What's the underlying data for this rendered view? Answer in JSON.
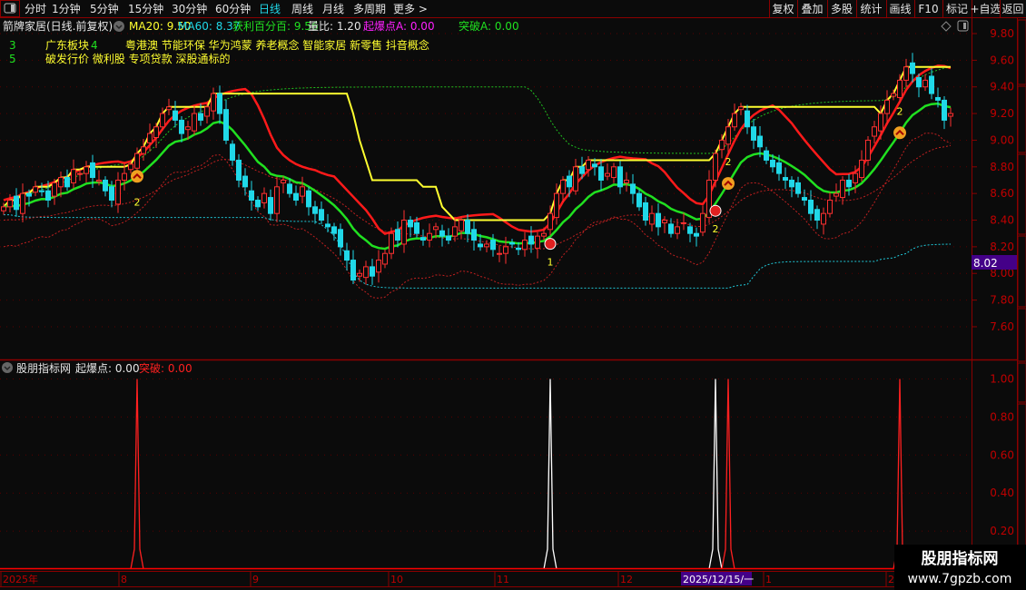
{
  "toolbar": {
    "periods": [
      "分时",
      "1分钟",
      "5分钟",
      "15分钟",
      "30分钟",
      "60分钟",
      "日线",
      "周线",
      "月线",
      "多周期",
      "更多 >"
    ],
    "active_period": "日线",
    "actions": [
      "复权",
      "叠加",
      "多股",
      "统计",
      "画线",
      "F10",
      "标记",
      "+自选",
      "返回"
    ]
  },
  "header": {
    "title": "箭牌家居(日线.前复权)",
    "ma20": "MA20: 9.50",
    "ma60": "MA60: 8.37",
    "profit": "获利百分百: 9.56",
    "volume_ratio": "量比: 1.20",
    "qibao_a": "起爆点A: 0.00",
    "tupo_a": "突破A: 0.00"
  },
  "info": {
    "row1_num": "3",
    "row1_label": "广东板块",
    "row1_count": "4",
    "row1_concepts": "粤港澳 节能环保 华为鸿蒙 养老概念 智能家居 新零售 抖音概念",
    "row2_num": "5",
    "row2_concepts": "破发行价 微利股 专项贷款 深股通标的"
  },
  "price_axis": {
    "ticks": [
      "9.80",
      "9.60",
      "9.40",
      "9.20",
      "9.00",
      "8.80",
      "8.60",
      "8.40",
      "8.20",
      "8.00",
      "7.80",
      "7.60"
    ],
    "current_price": "8.02"
  },
  "indicator": {
    "name": "股朋指标网",
    "qibao": "起爆点: 0.00",
    "tupo": "突破: 0.00",
    "ticks": [
      "1.00",
      "0.80",
      "0.60",
      "0.40",
      "0.20"
    ]
  },
  "date_axis": {
    "labels": [
      "2025年",
      "8",
      "9",
      "10",
      "11",
      "12",
      "1",
      "2"
    ],
    "cursor_date": "2025/12/15/一"
  },
  "watermark": {
    "line1": "股朋指标网",
    "line2": "www.7gpzb.com"
  },
  "colors": {
    "up": "#ff3030",
    "down": "#20d8e8",
    "ma_green": "#20e020",
    "band_red": "#ff1a1a",
    "step_yellow": "#ffff30",
    "axis": "#8b0000",
    "cursor_bg": "#440088"
  },
  "chart_data": {
    "type": "candlestick",
    "price_range": [
      7.5,
      9.85
    ],
    "closes": [
      8.5,
      8.55,
      8.48,
      8.6,
      8.58,
      8.65,
      8.62,
      8.55,
      8.68,
      8.72,
      8.65,
      8.78,
      8.75,
      8.8,
      8.72,
      8.7,
      8.62,
      8.55,
      8.7,
      8.75,
      8.82,
      8.9,
      8.95,
      9.05,
      9.1,
      9.2,
      9.25,
      9.15,
      9.05,
      9.1,
      9.2,
      9.15,
      9.25,
      9.35,
      9.2,
      9.0,
      8.85,
      8.7,
      8.65,
      8.55,
      8.5,
      8.6,
      8.45,
      8.65,
      8.7,
      8.6,
      8.55,
      8.65,
      8.5,
      8.45,
      8.4,
      8.35,
      8.3,
      8.2,
      8.1,
      7.95,
      8.0,
      8.05,
      7.98,
      8.1,
      8.15,
      8.3,
      8.25,
      8.4,
      8.35,
      8.3,
      8.25,
      8.3,
      8.35,
      8.28,
      8.25,
      8.35,
      8.4,
      8.3,
      8.25,
      8.2,
      8.22,
      8.18,
      8.15,
      8.2,
      8.22,
      8.18,
      8.25,
      8.22,
      8.28,
      8.3,
      8.45,
      8.6,
      8.7,
      8.65,
      8.8,
      8.75,
      8.85,
      8.8,
      8.7,
      8.75,
      8.8,
      8.65,
      8.7,
      8.6,
      8.5,
      8.4,
      8.45,
      8.35,
      8.4,
      8.3,
      8.35,
      8.38,
      8.3,
      8.28,
      8.45,
      8.7,
      8.9,
      9.0,
      9.1,
      9.2,
      9.25,
      9.1,
      9.0,
      8.95,
      8.85,
      8.8,
      8.75,
      8.7,
      8.65,
      8.6,
      8.55,
      8.45,
      8.4,
      8.45,
      8.55,
      8.6,
      8.7,
      8.65,
      8.75,
      8.85,
      9.0,
      9.1,
      9.2,
      9.3,
      9.35,
      9.45,
      9.55,
      9.5,
      9.4,
      9.45,
      9.35,
      9.3,
      9.15,
      9.2
    ],
    "signals": [
      {
        "index": 21,
        "label": "2",
        "kind": "qibao"
      },
      {
        "index": 86,
        "label": "1",
        "kind": "buy"
      },
      {
        "index": 112,
        "label": "2",
        "kind": "buy"
      },
      {
        "index": 114,
        "label": "2",
        "kind": "qibao"
      },
      {
        "index": 141,
        "label": "2",
        "kind": "qibao"
      }
    ],
    "indicator_spikes": [
      {
        "index": 21,
        "value": 1.0,
        "series": "突破"
      },
      {
        "index": 86,
        "value": 1.0,
        "series": "起爆点"
      },
      {
        "index": 112,
        "value": 1.0,
        "series": "起爆点"
      },
      {
        "index": 114,
        "value": 1.0,
        "series": "突破"
      },
      {
        "index": 141,
        "value": 1.0,
        "series": "突破"
      }
    ],
    "indicator_range": [
      0,
      1.05
    ]
  }
}
